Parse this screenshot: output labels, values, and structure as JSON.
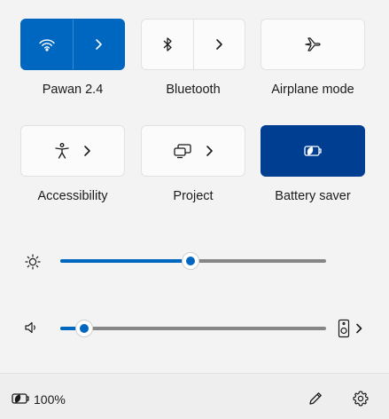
{
  "tiles": {
    "wifi": {
      "label": "Pawan 2.4",
      "state": "on"
    },
    "bluetooth": {
      "label": "Bluetooth",
      "state": "off"
    },
    "airplane": {
      "label": "Airplane mode",
      "state": "off"
    },
    "accessibility": {
      "label": "Accessibility"
    },
    "project": {
      "label": "Project"
    },
    "battery_saver": {
      "label": "Battery saver",
      "state": "on"
    }
  },
  "brightness": {
    "level": 0.49
  },
  "volume": {
    "level": 0.09
  },
  "footer": {
    "battery_percent": "100%"
  },
  "colors": {
    "accent": "#0067c0",
    "saver_on": "#003e92",
    "panel": "#f3f3f3"
  }
}
